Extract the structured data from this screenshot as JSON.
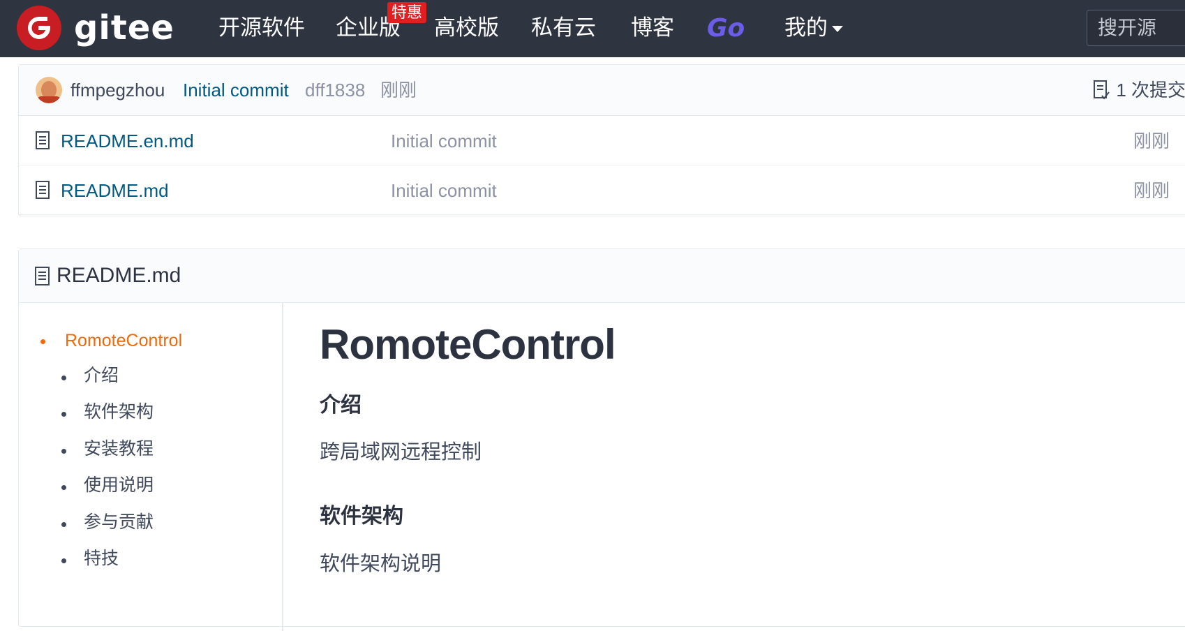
{
  "navbar": {
    "logo_text": "gitee",
    "items": [
      "开源软件",
      "企业版",
      "高校版",
      "私有云",
      "博客"
    ],
    "badge": "特惠",
    "go_label": "Go",
    "mine_label": "我的",
    "search_placeholder": "搜开源"
  },
  "commit": {
    "author": "ffmpegzhou",
    "message": "Initial commit",
    "hash": "dff1838",
    "time": "刚刚",
    "count_label": "1 次提交"
  },
  "files": [
    {
      "name": "README.en.md",
      "message": "Initial commit",
      "time": "刚刚"
    },
    {
      "name": "README.md",
      "message": "Initial commit",
      "time": "刚刚"
    }
  ],
  "readme": {
    "title": "README.md",
    "toc": {
      "main": "RomoteControl",
      "items": [
        "介绍",
        "软件架构",
        "安装教程",
        "使用说明",
        "参与贡献",
        "特技"
      ]
    },
    "content": {
      "h1": "RomoteControl",
      "sections": [
        {
          "heading": "介绍",
          "text": "跨局域网远程控制"
        },
        {
          "heading": "软件架构",
          "text": "软件架构说明"
        }
      ]
    }
  },
  "colors": {
    "navbar_bg": "#2f3441",
    "logo_red": "#c71d23",
    "link_blue": "#005980",
    "toc_active": "#f16a0a",
    "go_purple": "#6c5ce7"
  }
}
